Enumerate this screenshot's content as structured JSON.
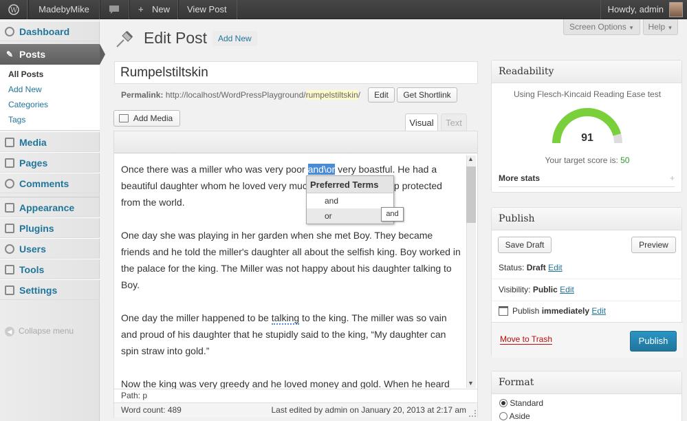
{
  "admin_bar": {
    "site_name": "MadebyMike",
    "new_label": "New",
    "view_post": "View Post",
    "howdy": "Howdy, admin"
  },
  "admin_menu": {
    "dashboard": "Dashboard",
    "posts": "Posts",
    "posts_sub": [
      "All Posts",
      "Add New",
      "Categories",
      "Tags"
    ],
    "media": "Media",
    "pages": "Pages",
    "comments": "Comments",
    "appearance": "Appearance",
    "plugins": "Plugins",
    "users": "Users",
    "tools": "Tools",
    "settings": "Settings",
    "collapse": "Collapse menu"
  },
  "header": {
    "screen_options": "Screen Options",
    "help": "Help",
    "title": "Edit Post",
    "add_new": "Add New"
  },
  "post": {
    "title": "Rumpelstiltskin",
    "permalink_label": "Permalink:",
    "permalink_base": "http://localhost/WordPressPlayground/",
    "permalink_slug": "rumpelstiltskin",
    "permalink_end": "/",
    "edit_btn": "Edit",
    "shortlink_btn": "Get Shortlink"
  },
  "editor": {
    "add_media": "Add Media",
    "tab_visual": "Visual",
    "tab_text": "Text",
    "p1_a": "Once there was a miller who was very poor ",
    "p1_hl": "and\\or",
    "p1_b": " very boastful. He had a beautiful daughter whom he loved very much and wanted to keep protected from the world.",
    "p2": "One day she was playing in her garden when she met Boy. They became friends and he told the miller's daughter all about the selfish king. Boy worked in the palace for the king. The Miller was not happy about his daughter talking to Boy.",
    "p3_a": "One day the miller happened to be ",
    "p3_u": "talking",
    "p3_b": " to the king. The miller was so vain and proud of his daughter that he stupidly said to the king, “My daughter can spin straw into gold.”",
    "p4": "Now the king was very greedy and he loved money and gold. When he heard",
    "path": "Path: p",
    "word_count": "Word count: 489",
    "last_edited": "Last edited by admin on January 20, 2013 at 2:17 am"
  },
  "dropdown": {
    "header": "Preferred Terms",
    "options": [
      "and",
      "or"
    ],
    "tooltip": "and"
  },
  "readability": {
    "title": "Readability",
    "test": "Using Flesch-Kincaid Reading Ease test",
    "score": "91",
    "score_value": 91,
    "target_label": "Your target score is:",
    "target": "50",
    "more_stats": "More stats",
    "plus": "+"
  },
  "publish": {
    "title": "Publish",
    "save_draft": "Save Draft",
    "preview": "Preview",
    "status_label": "Status:",
    "status_value": "Draft",
    "visibility_label": "Visibility:",
    "visibility_value": "Public",
    "publish_label": "Publish",
    "publish_value": "immediately",
    "edit": "Edit",
    "trash": "Move to Trash",
    "publish_btn": "Publish"
  },
  "format": {
    "title": "Format",
    "options": [
      "Standard",
      "Aside"
    ],
    "selected": "Standard"
  },
  "colors": {
    "accent": "#21759b",
    "publish_button": "#2a95c5",
    "gauge": "#7ad03a",
    "highlight": "#4a8bd6",
    "trash": "#bc0b0b"
  }
}
